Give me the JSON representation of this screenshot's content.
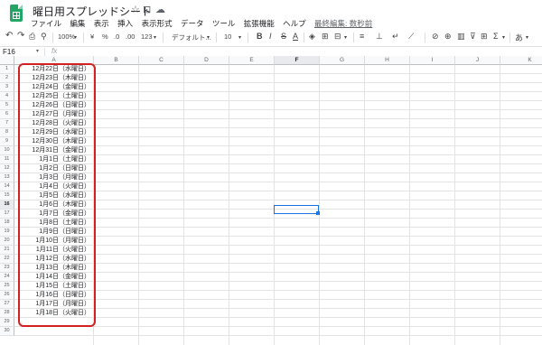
{
  "app": {
    "doc_title": "曜日用スプレッドシート",
    "title_icons": [
      "star-icon",
      "move-to-folder-icon",
      "cloud-status-icon"
    ],
    "star_glyph": "☆",
    "folder_glyph": "⊡",
    "cloud_glyph": "☁"
  },
  "menu": {
    "items": [
      "ファイル",
      "編集",
      "表示",
      "挿入",
      "表示形式",
      "データ",
      "ツール",
      "拡張機能",
      "ヘルプ"
    ],
    "last_edit": "最終編集: 数秒前"
  },
  "toolbar": {
    "undo": "↶",
    "redo": "↷",
    "print": "⎙",
    "paint_format": "⚲",
    "zoom": "100%",
    "currency": "¥",
    "percent": "%",
    "dec_decrease": ".0",
    "dec_increase": ".00",
    "more_formats": "123",
    "font": "デフォルト...",
    "font_size": "10",
    "bold": "B",
    "italic": "I",
    "strike": "S",
    "text_color": "A",
    "fill": "◈",
    "borders": "⊞",
    "merge": "⊟",
    "halign": "≡",
    "valign": "⊥",
    "wrap": "↵",
    "rotate": "⟋",
    "link": "⊘",
    "comment": "⊕",
    "chart": "▥",
    "filter": "⊽",
    "views": "⊞",
    "functions": "Σ",
    "input_tools": "あ"
  },
  "formula_bar": {
    "name_box": "F16",
    "fx": "fx",
    "value": ""
  },
  "columns": [
    "A",
    "B",
    "C",
    "D",
    "E",
    "F",
    "G",
    "H",
    "I",
    "J",
    "K"
  ],
  "selected_column": "F",
  "rows": [
    "1",
    "2",
    "3",
    "4",
    "5",
    "6",
    "7",
    "8",
    "9",
    "10",
    "11",
    "12",
    "13",
    "14",
    "15",
    "16",
    "17",
    "18",
    "19",
    "20",
    "21",
    "22",
    "23",
    "24",
    "25",
    "26",
    "27",
    "28",
    "29",
    "30"
  ],
  "selected_row": "16",
  "column_a": [
    "12月22日（水曜日）",
    "12月23日（木曜日）",
    "12月24日（金曜日）",
    "12月25日（土曜日）",
    "12月26日（日曜日）",
    "12月27日（月曜日）",
    "12月28日（火曜日）",
    "12月29日（水曜日）",
    "12月30日（木曜日）",
    "12月31日（金曜日）",
    "1月1日（土曜日）",
    "1月2日（日曜日）",
    "1月3日（月曜日）",
    "1月4日（火曜日）",
    "1月5日（水曜日）",
    "1月6日（木曜日）",
    "1月7日（金曜日）",
    "1月8日（土曜日）",
    "1月9日（日曜日）",
    "1月10日（月曜日）",
    "1月11日（火曜日）",
    "1月12日（水曜日）",
    "1月13日（木曜日）",
    "1月14日（金曜日）",
    "1月15日（土曜日）",
    "1月16日（日曜日）",
    "1月17日（月曜日）",
    "1月18日（火曜日）"
  ],
  "colors": {
    "highlight": "#d32020",
    "active_cell": "#1a73e8",
    "logo": "#23a566"
  }
}
